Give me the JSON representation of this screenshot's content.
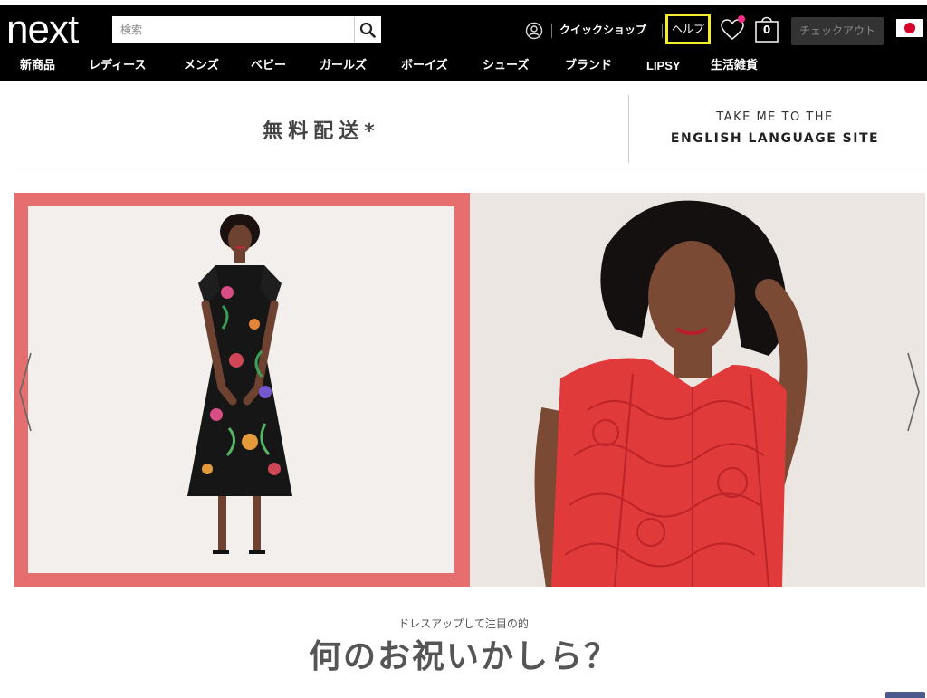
{
  "header": {
    "logo": "next",
    "search": {
      "placeholder": "検索"
    },
    "quickshop": "クイックショップ",
    "help": "ヘルプ",
    "bag_count": "0",
    "checkout": "チェックアウト",
    "colors": {
      "bar": "#000000",
      "highlight": "#f6ec2c",
      "wish_dot": "#ff2a8a"
    }
  },
  "nav": {
    "items": [
      "新商品",
      "レディース",
      "メンズ",
      "ベビー",
      "ガールズ",
      "ボーイズ",
      "シューズ",
      "ブランド",
      "LIPSY",
      "生活雑貨"
    ]
  },
  "promo": {
    "free_shipping": "無料配送*",
    "english_line1": "TAKE ME TO THE",
    "english_line2": "ENGLISH LANGUAGE SITE"
  },
  "hero": {
    "colors": {
      "frame": "#e66e6e",
      "left_dress": "#1a1a1a",
      "right_dress": "#e03a3a"
    }
  },
  "section": {
    "subtitle": "ドレスアップして注目の的",
    "headline": "何のお祝いかしら？"
  }
}
